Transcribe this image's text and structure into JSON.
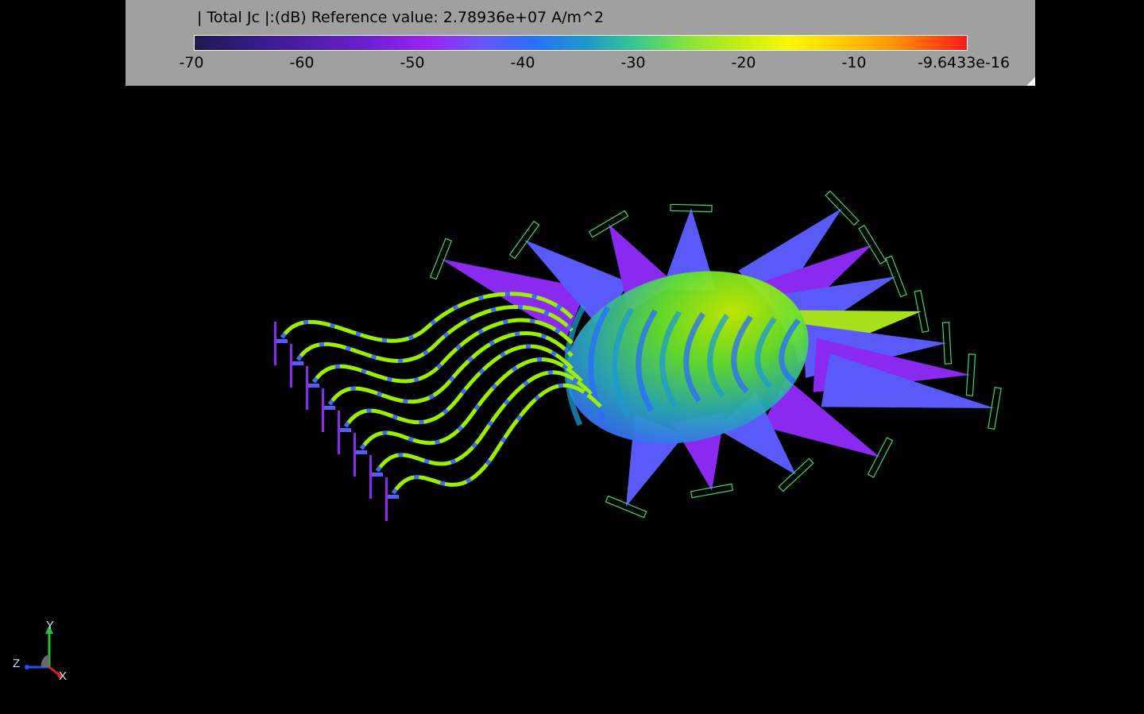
{
  "legend": {
    "title": "| Total Jc |:(dB) Reference value: 2.78936e+07 A/m^2",
    "ticks": [
      "-70",
      "-60",
      "-50",
      "-40",
      "-30",
      "-20",
      "-10",
      "-9.6433e-16"
    ]
  },
  "axes": {
    "y": "Y",
    "z": "Z",
    "x": "X"
  },
  "colors": {
    "background": "#000000",
    "panel": "#a0a0a0",
    "port_outline": "#33dd66"
  }
}
